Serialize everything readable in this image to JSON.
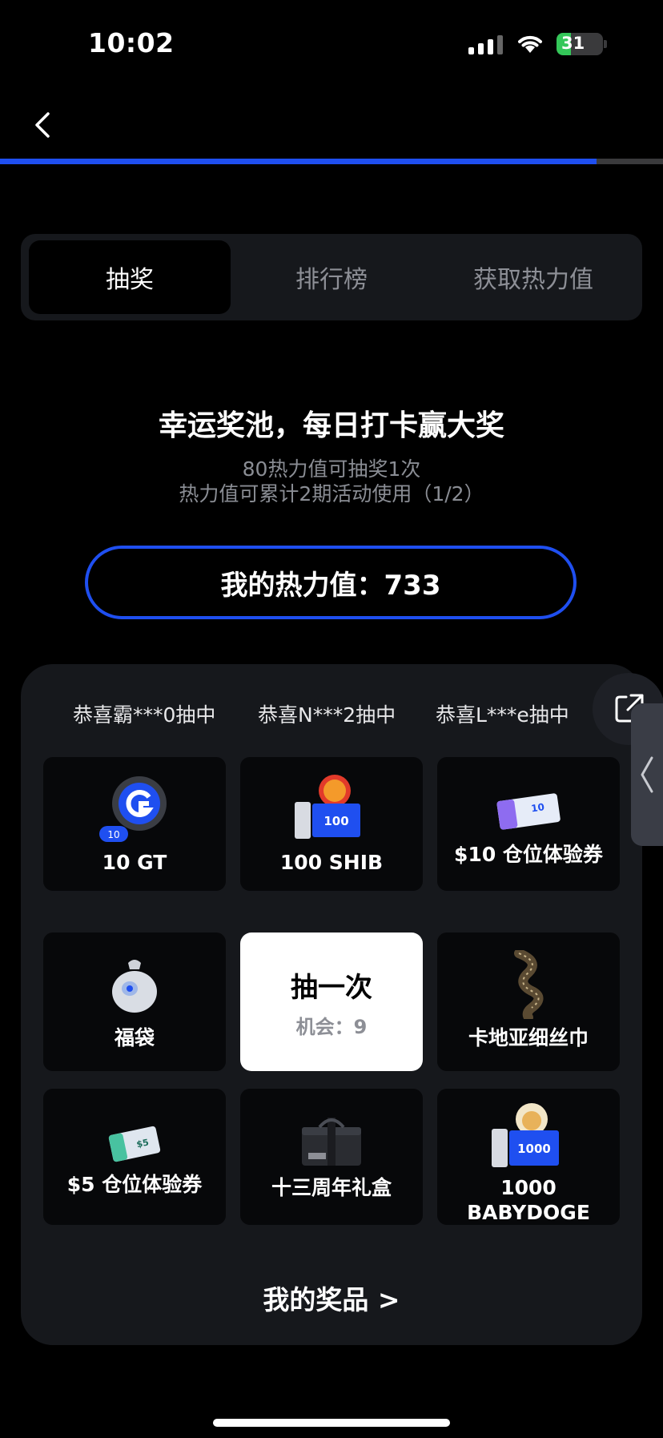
{
  "status_bar": {
    "time": "10:02",
    "battery": "31",
    "battery_level": 0.31
  },
  "page_progress": 0.9,
  "tabs": [
    {
      "label": "抽奖",
      "active": true
    },
    {
      "label": "排行榜",
      "active": false
    },
    {
      "label": "获取热力值",
      "active": false
    }
  ],
  "heading": "幸运奖池，每日打卡赢大奖",
  "subtitle_1": "80热力值可抽奖1次",
  "subtitle_2": "热力值可累计2期活动使用（1/2）",
  "heat_value": "我的热力值：733",
  "ticker": [
    "恭喜霸***0抽中",
    "恭喜N***2抽中",
    "恭喜L***e抽中"
  ],
  "prizes": [
    {
      "label": "10 GT",
      "icon": "gt-token-icon",
      "badge": "10"
    },
    {
      "label": "100 SHIB",
      "icon": "shib-coupon-icon",
      "badge": "100"
    },
    {
      "label": "$10 仓位体验券",
      "icon": "usdt-voucher-icon",
      "badge": "10"
    },
    {
      "label": "福袋",
      "icon": "lucky-bag-icon"
    },
    {
      "label": "卡地亚细丝巾",
      "icon": "silk-scarf-icon"
    },
    {
      "label": "$5 仓位体验券",
      "icon": "usdt-voucher-icon",
      "badge": "$5"
    },
    {
      "label": "十三周年礼盒",
      "icon": "gift-box-icon"
    },
    {
      "label": "1000 BABYDOGE",
      "icon": "babydoge-coupon-icon",
      "badge": "1000"
    }
  ],
  "draw": {
    "label": "抽一次",
    "chances": "机会：9"
  },
  "my_prizes": "我的奖品 >",
  "colors": {
    "accent": "#1f4ff0",
    "background": "#000000",
    "card": "#16181c",
    "tile": "#07080a"
  }
}
